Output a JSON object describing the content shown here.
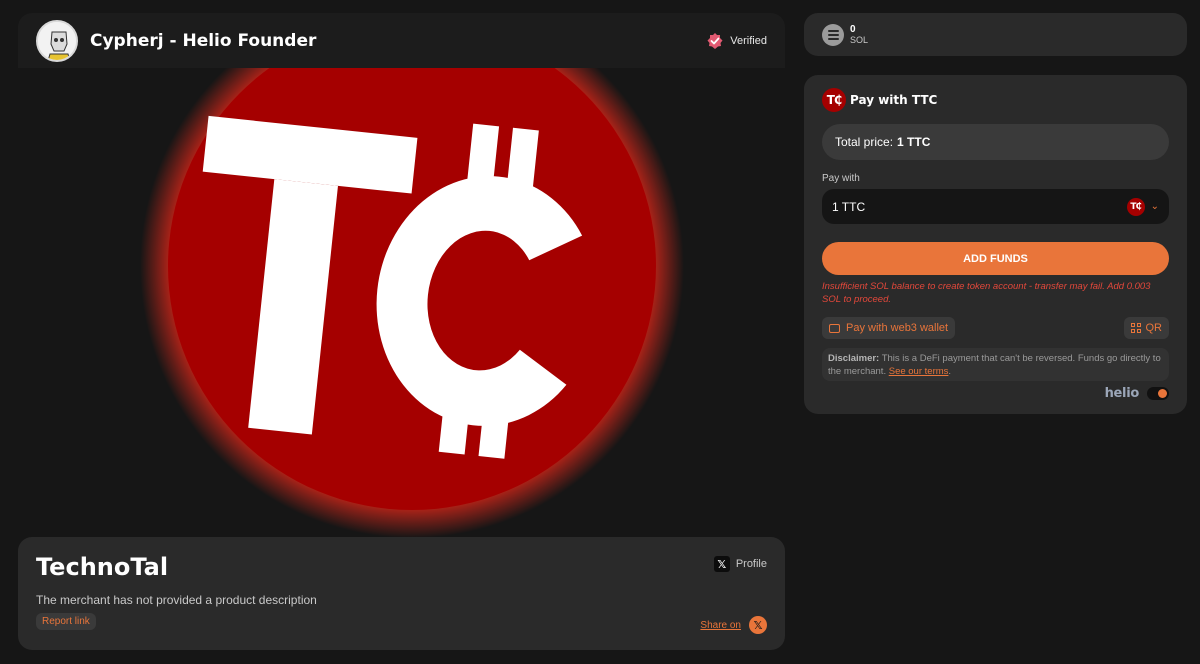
{
  "merchant": {
    "name": "Cypherj - Helio Founder",
    "verified_label": "Verified"
  },
  "hero": {
    "logo_text": "T₵",
    "logo_color": "#a50000"
  },
  "product": {
    "title": "TechnoTal",
    "description": "The merchant has not provided a product description",
    "report_label": "Report link",
    "profile_label": "Profile",
    "share_label": "Share on"
  },
  "balance": {
    "amount": "0",
    "unit": "SOL"
  },
  "payment": {
    "title": "Pay with TTC",
    "total_price_label": "Total price:",
    "total_price_value": "1 TTC",
    "pay_with_label": "Pay with",
    "selected_option": "1 TTC",
    "add_funds_label": "ADD FUNDS",
    "warning": "Insufficient SOL balance to create token account - transfer may fail. Add 0.003 SOL to proceed.",
    "web3_label": "Pay with web3 wallet",
    "qr_label": "QR",
    "disclaimer_title": "Disclaimer:",
    "disclaimer_text": "This is a DeFi payment that can't be reversed. Funds go directly to the merchant.",
    "terms_link": "See our terms",
    "disclaimer_end": ".",
    "brand": "helio",
    "accent_color": "#e9753a"
  },
  "icons": {
    "verified": "verified-badge-icon",
    "sol": "solana-icon",
    "x": "x-logo-icon",
    "wallet": "wallet-icon",
    "qr": "qr-code-icon",
    "chevron": "chevron-down-icon"
  }
}
